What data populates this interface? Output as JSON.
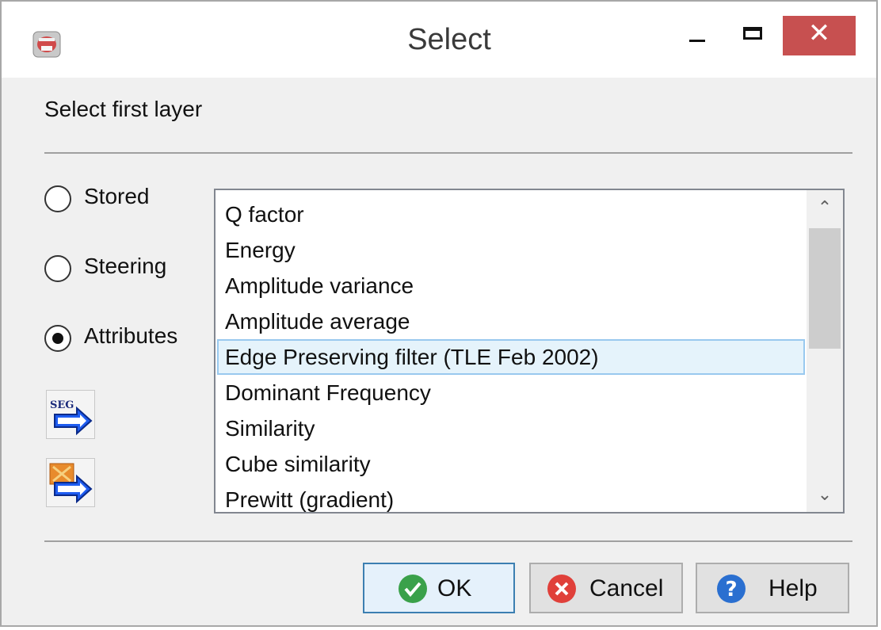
{
  "window": {
    "title": "Select"
  },
  "title_controls": {
    "close_glyph": "✕"
  },
  "dialog": {
    "heading": "Select first layer"
  },
  "sources": [
    {
      "label": "Stored",
      "checked": false
    },
    {
      "label": "Steering",
      "checked": false
    },
    {
      "label": "Attributes",
      "checked": true
    }
  ],
  "side_buttons": {
    "segy_text": "SEG",
    "segy_icon": "segy-import-arrow-icon",
    "folder_icon": "folder-import-arrow-icon"
  },
  "attributes_list": {
    "items": [
      "Q factor",
      "Energy",
      "Amplitude variance",
      "Amplitude average",
      "Edge Preserving filter (TLE Feb 2002)",
      "Dominant Frequency",
      "Similarity",
      "Cube similarity",
      "Prewitt (gradient)"
    ],
    "selected_index": 4
  },
  "buttons": {
    "ok": "OK",
    "cancel": "Cancel",
    "help": "Help"
  },
  "colors": {
    "close_button": "#c75050",
    "selection_fill": "#e5f3fb",
    "selection_border": "#99c9ef",
    "default_button_border": "#3c7fb1"
  }
}
